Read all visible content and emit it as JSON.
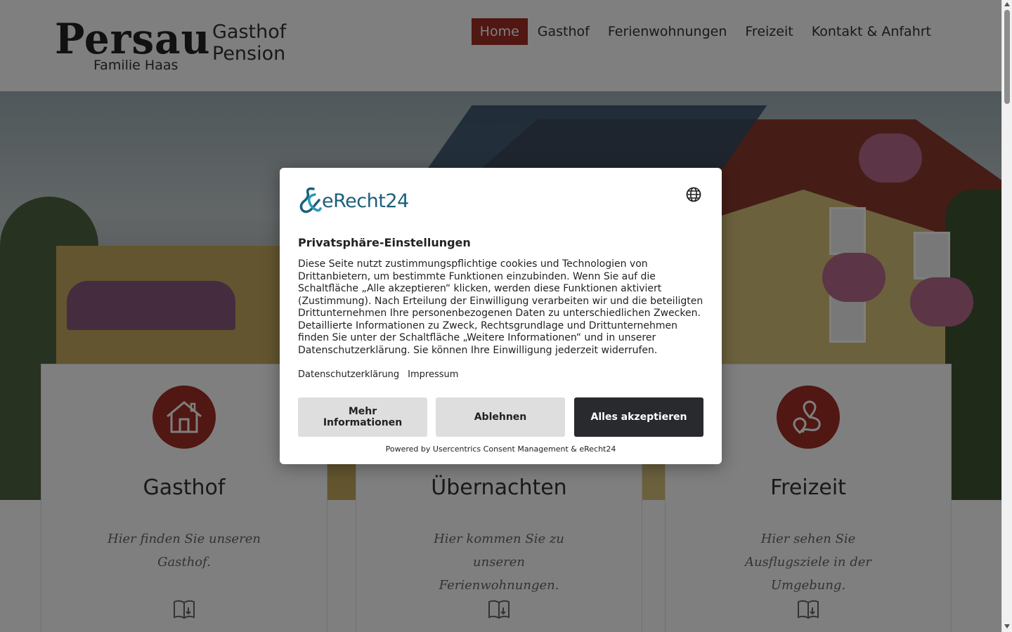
{
  "header": {
    "logo_word": "Persau",
    "logo_family": "Familie Haas",
    "subtitle_line1": "Gasthof",
    "subtitle_line2": "Pension",
    "nav": [
      {
        "label": "Home",
        "active": true
      },
      {
        "label": "Gasthof",
        "active": false
      },
      {
        "label": "Ferienwohnungen",
        "active": false
      },
      {
        "label": "Freizeit",
        "active": false
      },
      {
        "label": "Kontakt & Anfahrt",
        "active": false
      }
    ]
  },
  "cards": [
    {
      "title": "Gasthof",
      "text": "Hier finden Sie unseren Gasthof.",
      "icon": "house-icon"
    },
    {
      "title": "Übernachten",
      "text": "Hier kommen Sie zu unseren Ferienwohnungen.",
      "icon": "bed-icon"
    },
    {
      "title": "Freizeit",
      "text": "Hier sehen Sie Ausflugsziele in der Umgebung.",
      "icon": "route-pin-icon"
    }
  ],
  "consent": {
    "brand": "eRecht24",
    "title": "Privatsphäre-Einstellungen",
    "body": "Diese Seite nutzt zustimmungspflichtige cookies und Technologien von Drittanbietern, um bestimmte Funktionen einzubinden. Wenn Sie auf die Schaltfläche „Alle akzeptieren“ klicken, werden diese Funktionen aktiviert (Zustimmung). Nach Erteilung der Einwilligung verarbeiten wir und die beteiligten Drittunternehmen Ihre personenbezogenen Daten zu unterschiedlichen Zwecken. Detaillierte Informationen zu Zweck, Rechtsgrundlage und Drittunternehmen finden Sie unter der Schaltfläche „Weitere Informationen“ und in unserer Datenschutzerklärung. Sie können Ihre Einwilligung jederzeit widerrufen.",
    "link_privacy": "Datenschutzerklärung",
    "link_imprint": "Impressum",
    "btn_more": "Mehr Informationen",
    "btn_deny": "Ablehnen",
    "btn_accept": "Alles akzeptieren",
    "powered": "Powered by Usercentrics Consent Management & eRecht24"
  },
  "colors": {
    "accent": "#a12f27",
    "dark_button": "#282a2e",
    "brand_blue": "#1c5f7a"
  }
}
